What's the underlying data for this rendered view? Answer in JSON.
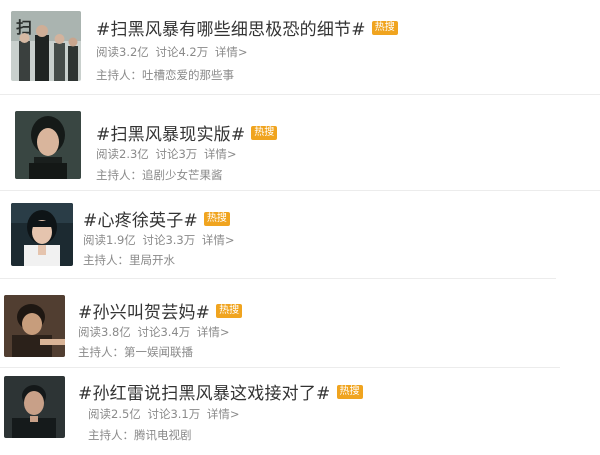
{
  "topics": [
    {
      "title": "#扫黑风暴有哪些细思极恐的细节#",
      "badge": "热搜",
      "reads": "阅读3.2亿",
      "comments": "讨论4.2万",
      "detail": "详情>",
      "host_label": "主持人：",
      "host": "吐槽恋爱的那些事",
      "thumb_palette": [
        "#7f8b86",
        "#2d3431",
        "#d8dcd9"
      ]
    },
    {
      "title": "#扫黑风暴现实版#",
      "badge": "热搜",
      "reads": "阅读2.3亿",
      "comments": "讨论3万",
      "detail": "详情>",
      "host_label": "主持人：",
      "host": "追剧少女芒果酱",
      "thumb_palette": [
        "#3d4a46",
        "#1d2321",
        "#d9b59c"
      ]
    },
    {
      "title": "#心疼徐英子#",
      "badge": "热搜",
      "reads": "阅读1.9亿",
      "comments": "讨论3.3万",
      "detail": "详情>",
      "host_label": "主持人：",
      "host": "里局开水",
      "thumb_palette": [
        "#1a2a33",
        "#0c1418",
        "#e5c4ae"
      ]
    },
    {
      "title": "#孙兴叫贺芸妈#",
      "badge": "热搜",
      "reads": "阅读3.8亿",
      "comments": "讨论3.4万",
      "detail": "详情>",
      "host_label": "主持人：",
      "host": "第一娱闻联播",
      "thumb_palette": [
        "#5b4636",
        "#2b211a",
        "#c79d7c"
      ]
    },
    {
      "title": "#孙红雷说扫黑风暴这戏接对了#",
      "badge": "热搜",
      "reads": "阅读2.5亿",
      "comments": "讨论3.1万",
      "detail": "详情>",
      "host_label": "主持人：",
      "host": "腾讯电视剧",
      "thumb_palette": [
        "#2d3435",
        "#151a1b",
        "#c8a088"
      ]
    }
  ]
}
